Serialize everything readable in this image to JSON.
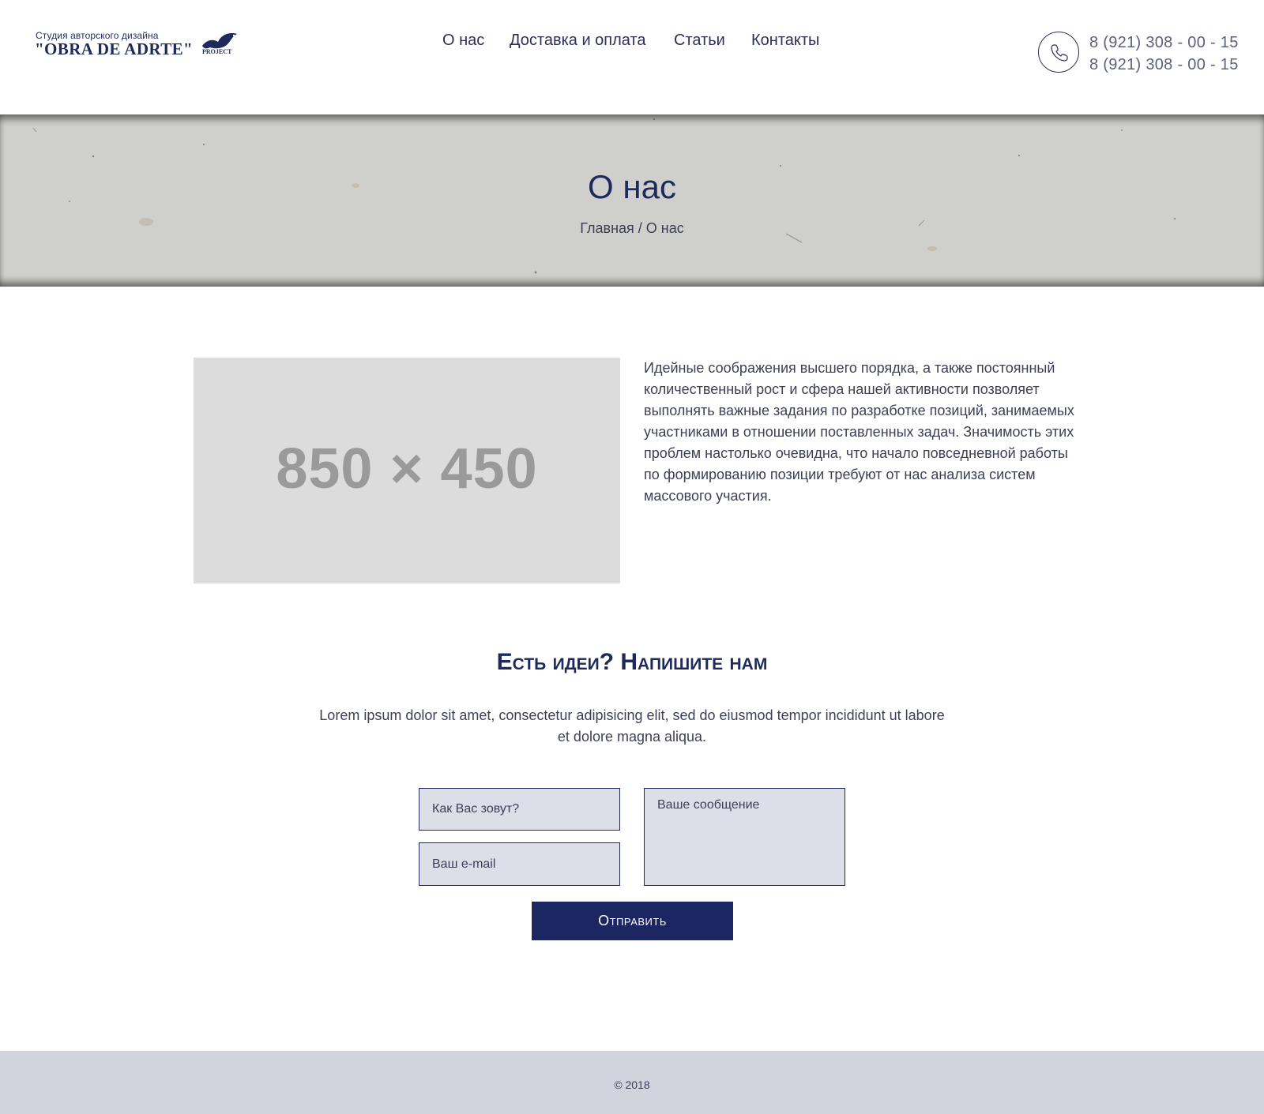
{
  "header": {
    "logo": {
      "tagline": "Студия авторского дизайна",
      "name": "\"OBRA DE ADRTE\"",
      "sub": "PROJECT"
    },
    "nav": [
      {
        "label": "О нас"
      },
      {
        "label": "Доставка и оплата"
      },
      {
        "label": "Статьи"
      },
      {
        "label": "Контакты"
      }
    ],
    "phone_icon": "phone-icon",
    "phones": [
      "8 (921) 308 - 00 - 15",
      "8 (921) 308 - 00 - 15"
    ]
  },
  "banner": {
    "title": "О нас",
    "breadcrumb": {
      "home": "Главная",
      "separator": " / ",
      "current": "О нас"
    }
  },
  "about": {
    "image_placeholder": "850 × 450",
    "text": "Идейные соображения высшего порядка, а также постоянный количественный рост и сфера нашей активности позволяет выполнять важные задания по разработке позиций, занимаемых участниками в отношении поставленных задач. Значимость этих проблем настолько очевидна, что начало повседневной работы по формированию позиции требуют от нас анализа систем массового участия."
  },
  "contact": {
    "title": "Есть идеи? Напишите нам",
    "description": "Lorem ipsum dolor sit amet, consectetur adipisicing elit, sed do eiusmod tempor incididunt ut labore et dolore magna aliqua.",
    "name_placeholder": "Как Вас зовут?",
    "email_placeholder": "Ваш e-mail",
    "message_placeholder": "Ваше сообщение",
    "submit_label": "Отправить"
  },
  "footer": {
    "copyright": "© 2018"
  },
  "colors": {
    "brand": "#1f2a5c",
    "button": "#1c2660",
    "input_bg": "#dcdfe7",
    "footer_bg": "#d2d4dd",
    "banner_bg": "#cfcfcb"
  }
}
